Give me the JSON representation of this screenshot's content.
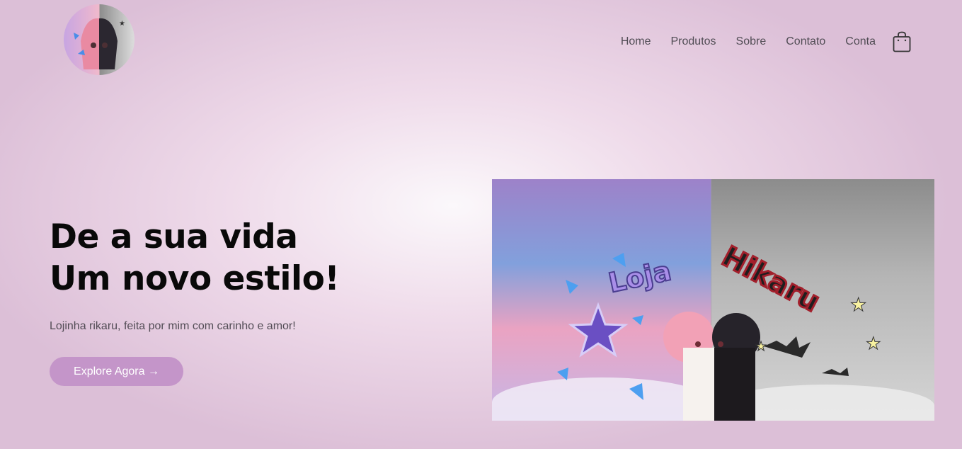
{
  "nav": {
    "items": [
      "Home",
      "Produtos",
      "Sobre",
      "Contato",
      "Conta"
    ],
    "cart_icon": "shopping-bag-icon"
  },
  "hero": {
    "title_line1": "De a sua vida",
    "title_line2": "Um novo estilo!",
    "subtitle": "Lojinha rikaru, feita por mim com carinho e amor!",
    "cta_label": "Explore Agora →"
  },
  "banner": {
    "text_left": "Loja",
    "text_right": "Hikaru"
  },
  "colors": {
    "accent": "#c495c9",
    "nav_text": "#514d55",
    "title": "#090909"
  }
}
